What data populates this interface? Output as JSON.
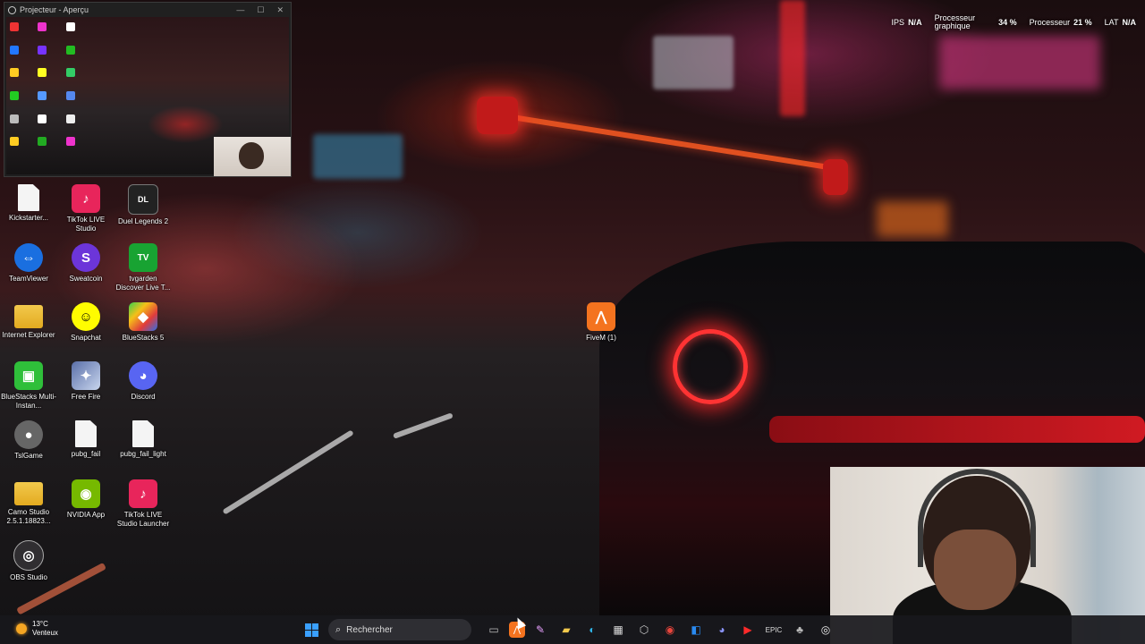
{
  "projector_window": {
    "title": "Projecteur - Aperçu",
    "controls": [
      "—",
      "☐",
      "✕"
    ]
  },
  "stats_overlay": {
    "ips_label": "IPS",
    "ips_value": "N/A",
    "gpu_label_line1": "Processeur",
    "gpu_label_line2": "graphique",
    "gpu_value": "34 %",
    "cpu_label": "Processeur",
    "cpu_value": "21 %",
    "lat_label": "LAT",
    "lat_value": "N/A"
  },
  "desktop_icons": [
    {
      "id": "kickstarter",
      "label": "Kickstarter..."
    },
    {
      "id": "tiktok-live-studio",
      "label": "TikTok LIVE Studio"
    },
    {
      "id": "duel-legends",
      "label": "Duel Legends 2"
    },
    {
      "id": "teamviewer",
      "label": "TeamViewer"
    },
    {
      "id": "sweatcoin",
      "label": "Sweatcoin"
    },
    {
      "id": "tv-garden",
      "label": "tvgarden Discover Live T..."
    },
    {
      "id": "internet-explorer",
      "label": "Internet Explorer"
    },
    {
      "id": "snapchat",
      "label": "Snapchat"
    },
    {
      "id": "bluestacks5",
      "label": "BlueStacks 5"
    },
    {
      "id": "bluestacks-multi",
      "label": "BlueStacks Multi-Instan..."
    },
    {
      "id": "free-fire",
      "label": "Free Fire"
    },
    {
      "id": "discord",
      "label": "Discord"
    },
    {
      "id": "tslgame",
      "label": "TslGame"
    },
    {
      "id": "pubg-fail",
      "label": "pubg_fail"
    },
    {
      "id": "pubg-fail-light",
      "label": "pubg_fail_light"
    },
    {
      "id": "camo-studio",
      "label": "Camo Studio 2.5.1.18823..."
    },
    {
      "id": "nvidia-app",
      "label": "NVIDIA App"
    },
    {
      "id": "tiktok-live-launcher",
      "label": "TikTok LIVE Studio Launcher"
    },
    {
      "id": "obs-studio",
      "label": "OBS Studio"
    },
    {
      "id": "fivem",
      "label": "FiveM (1)"
    }
  ],
  "taskbar": {
    "weather_temp": "13°C",
    "weather_desc": "Venteux",
    "search_placeholder": "Rechercher"
  },
  "colors": {
    "accent": "#3aa0ff",
    "taillight": "#ff3333"
  }
}
